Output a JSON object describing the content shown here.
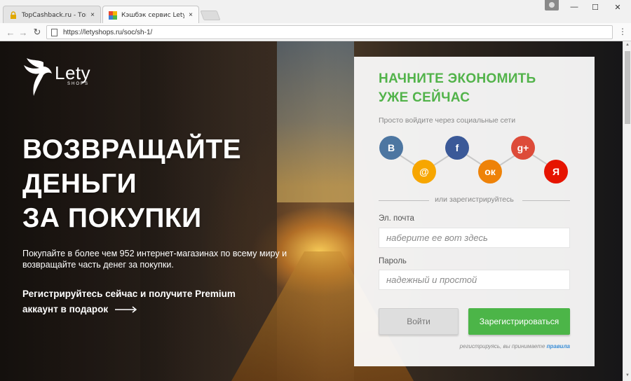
{
  "browser": {
    "tabs": [
      {
        "title": "TopCashback.ru - Топ лу",
        "close": "×"
      },
      {
        "title": "Кэшбэк сервис LetyShop",
        "close": "×"
      }
    ],
    "url": "https://letyshops.ru/soc/sh-1/",
    "window_controls": {
      "minimize": "—",
      "maximize": "☐",
      "close": "✕"
    },
    "nav": {
      "back": "←",
      "forward": "→",
      "reload": "↻"
    },
    "menu": "⋮"
  },
  "brand": {
    "name": "Lety",
    "sub": "SHOPS"
  },
  "hero": {
    "headline": [
      "ВОЗВРАЩАЙТЕ",
      "ДЕНЬГИ",
      "ЗА ПОКУПКИ"
    ],
    "subtext": "Покупайте в более чем 952 интернет-магазинах по всему миру и возвращайте часть денег за покупки.",
    "promo": "Регистрируйтесь сейчас и получите Premium аккаунт в подарок"
  },
  "signup": {
    "title_line1": "НАЧНИТЕ ЭКОНОМИТЬ",
    "title_line2": "УЖЕ СЕЙЧАС",
    "social_label": "Просто войдите через социальные сети",
    "social": [
      {
        "name": "vkontakte",
        "glyph": "B",
        "color": "#4d76a1"
      },
      {
        "name": "mail",
        "glyph": "@",
        "color": "#f7a600"
      },
      {
        "name": "facebook",
        "glyph": "f",
        "color": "#3b5998"
      },
      {
        "name": "odnoklassniki",
        "glyph": "ок",
        "color": "#ee8208"
      },
      {
        "name": "googleplus",
        "glyph": "g+",
        "color": "#dd4b39"
      },
      {
        "name": "yandex",
        "glyph": "Я",
        "color": "#e61400"
      }
    ],
    "or_label": "или зарегистрируйтесь",
    "email_label": "Эл. почта",
    "email_placeholder": "наберите ее вот здесь",
    "password_label": "Пароль",
    "password_placeholder": "надежный и простой",
    "login_button": "Войти",
    "register_button": "Зарегистрироваться",
    "terms_text": "регистрируясь, вы принимаете",
    "terms_link": "правила"
  }
}
